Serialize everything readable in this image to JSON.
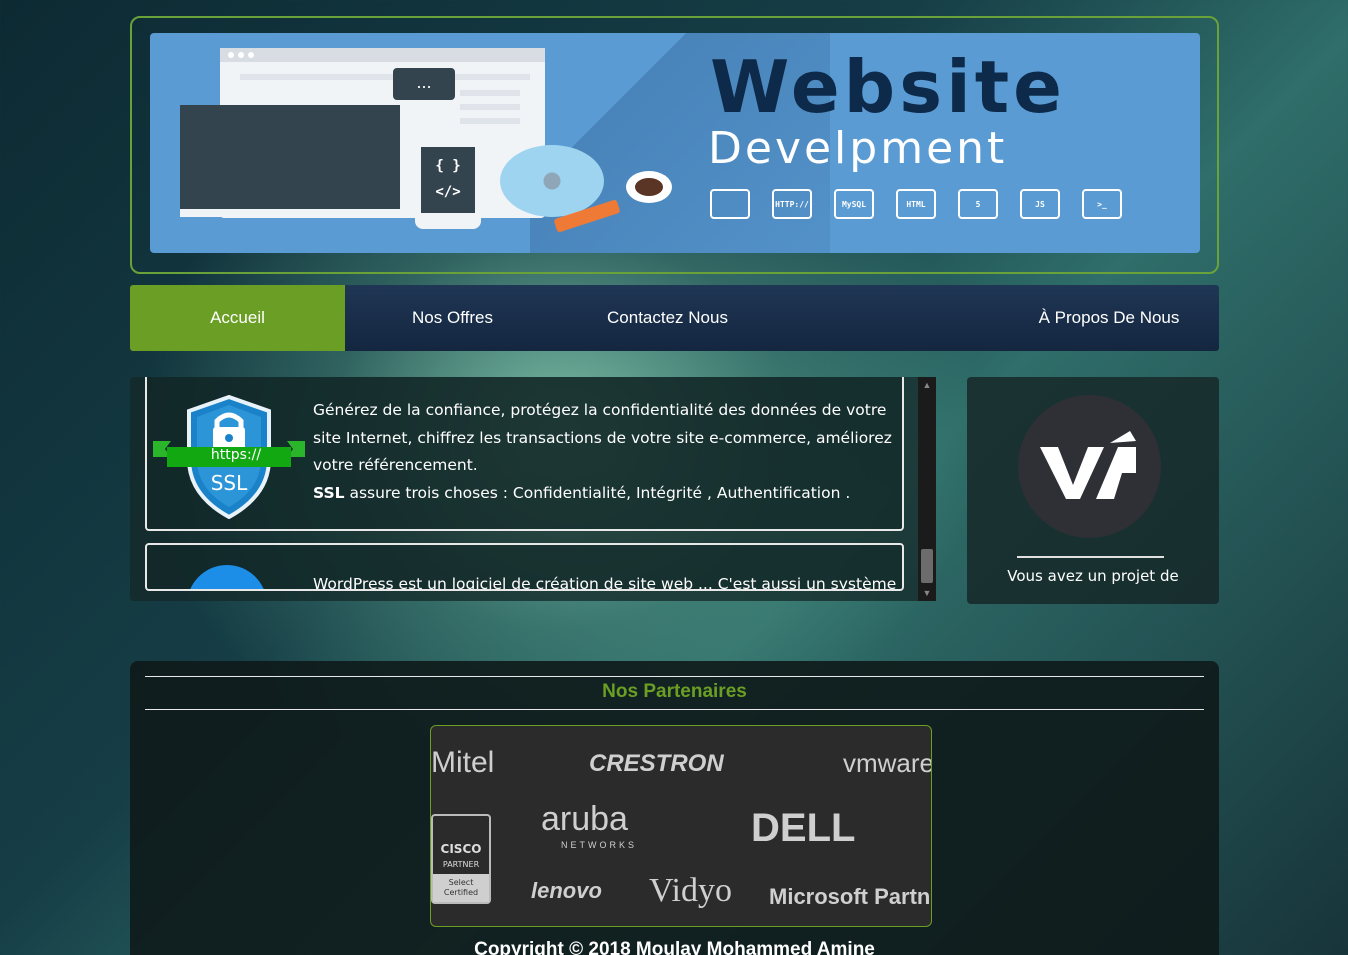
{
  "banner": {
    "title_line1": "Website",
    "title_line2": "Develpment",
    "code_braces": "{ }",
    "code_tag": "</>",
    "bubble_text": "...",
    "tech_icons": [
      "puzzle-icon",
      "HTTP://",
      "MySQL",
      "HTML",
      "html5-icon",
      "JS",
      "terminal-icon"
    ],
    "tech_labels": [
      "",
      "HTTP://",
      "MySQL",
      "HTML",
      "5",
      "JS",
      ">_"
    ]
  },
  "nav": {
    "items": [
      {
        "label": "Accueil",
        "active": true
      },
      {
        "label": "Nos Offres",
        "active": false
      },
      {
        "label": "Contactez Nous",
        "active": false
      },
      {
        "label": "À Propos De Nous",
        "active": false
      }
    ]
  },
  "main": {
    "card1": {
      "badge_text": "https://",
      "badge_label": "SSL",
      "paragraph": "Générez de la confiance, protégez la confidentialité des données de votre site Internet, chiffrez les transactions de votre site e-commerce, améliorez votre référencement.",
      "bold_term": "SSL",
      "summary": " assure trois choses : Confidentialité, Intégrité , Authentification ."
    },
    "card2": {
      "paragraph": "WordPress est un logiciel de création de site web ... C'est aussi un système"
    }
  },
  "side": {
    "text": "Vous avez un projet de"
  },
  "partners": {
    "title": "Nos Partenaires",
    "logos": [
      "Mitel",
      "CRESTRON",
      "vmware",
      "aruba",
      "NETWORKS",
      "DELL",
      "lenovo",
      "Vidyo",
      "Microsoft Partner"
    ],
    "cisco": {
      "name": "CISCO",
      "sub": "PARTNER",
      "foot1": "Select",
      "foot2": "Certified"
    }
  },
  "footer": {
    "copyright": "Copyright © 2018 Moulay Mohammed Amine"
  },
  "colors": {
    "accent_green": "#6a9e24",
    "nav_bg": "#1f3654",
    "banner_bg": "#5a9bd3"
  }
}
